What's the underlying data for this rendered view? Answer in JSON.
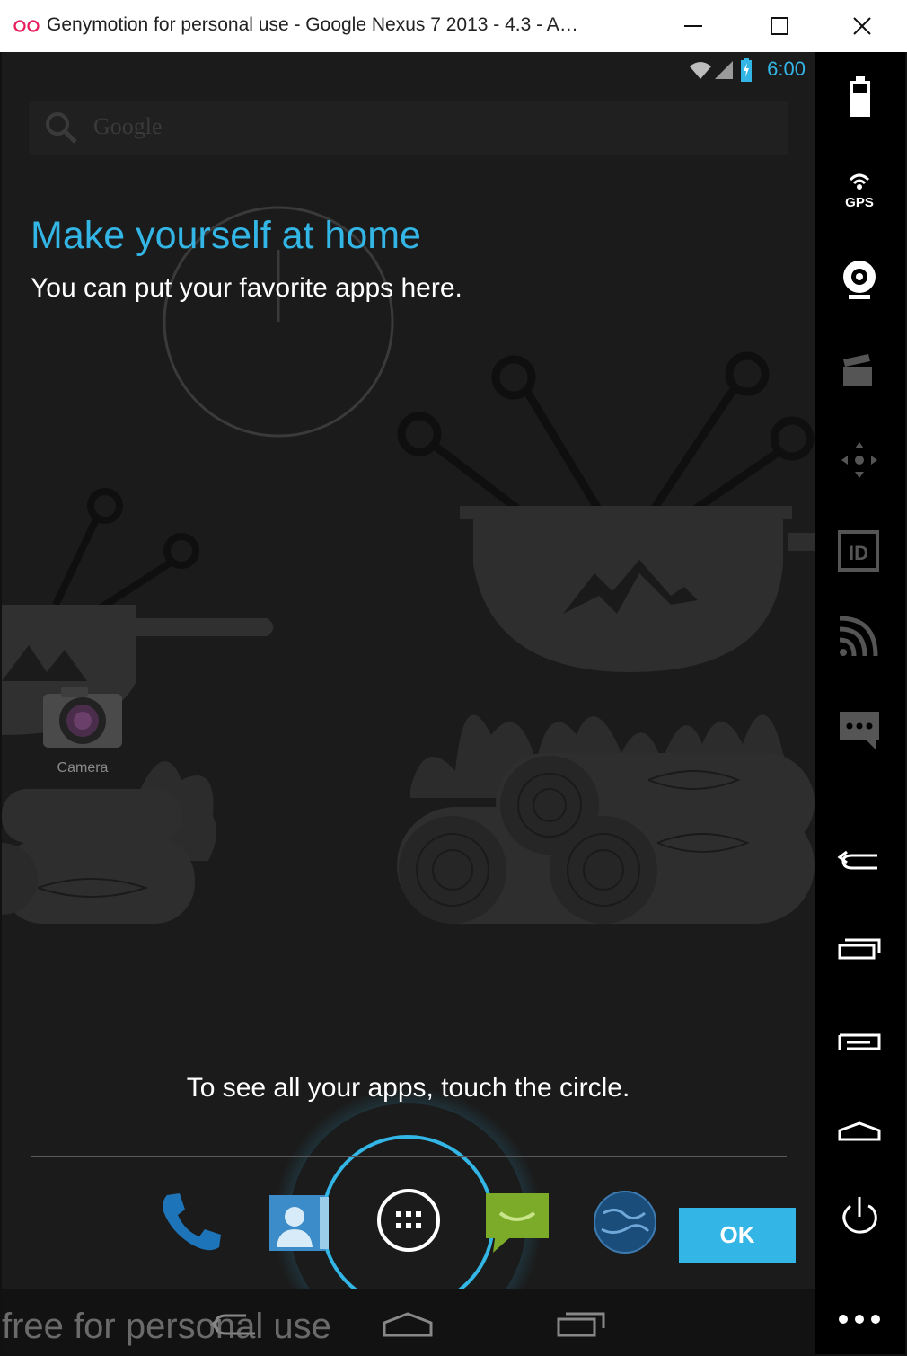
{
  "window": {
    "title": "Genymotion for personal use - Google Nexus 7 2013 - 4.3 - A…",
    "controls": [
      "minimize",
      "maximize",
      "close"
    ]
  },
  "statusbar": {
    "time": "6:00"
  },
  "search": {
    "placeholder": "Google"
  },
  "cling": {
    "title": "Make yourself at home",
    "body": "You can put your favorite apps here.",
    "hint": "To see all your apps, touch the circle.",
    "ok_label": "OK"
  },
  "workspace": {
    "apps": [
      {
        "label": "Camera",
        "icon": "camera-icon"
      }
    ]
  },
  "hotseat": {
    "icons": [
      "phone-icon",
      "contacts-icon",
      "all-apps-icon",
      "messaging-icon",
      "browser-icon"
    ]
  },
  "navbar": {
    "buttons": [
      "back-icon",
      "home-icon",
      "recents-icon"
    ]
  },
  "watermark": "free for personal use",
  "sidebar": {
    "tools": [
      "battery-icon",
      "gps-icon",
      "webcam-icon",
      "screencast-icon",
      "remote-control-icon",
      "device-id-icon",
      "network-icon",
      "sms-icon",
      "back-icon",
      "recent-apps-icon",
      "menu-icon",
      "home-icon",
      "power-icon",
      "more-icon"
    ],
    "gps_label": "GPS",
    "id_label": "ID"
  },
  "colors": {
    "accent": "#33b5e5",
    "screen_bg": "#1b1b1b",
    "sidebar_bg": "#000000"
  }
}
